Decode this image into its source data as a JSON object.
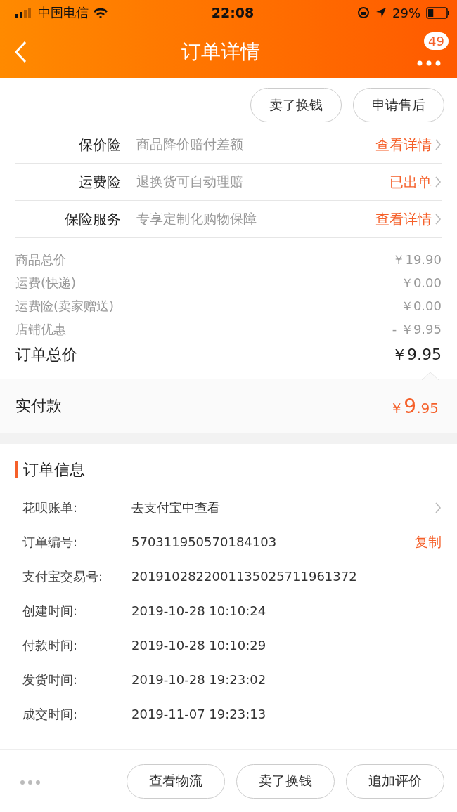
{
  "status_bar": {
    "carrier": "中国电信",
    "time": "22:08",
    "battery": "29%"
  },
  "nav": {
    "title": "订单详情",
    "badge": "49"
  },
  "top_actions": [
    "卖了换钱",
    "申请售后"
  ],
  "services": [
    {
      "label": "保价险",
      "desc": "商品降价赔付差额",
      "action": "查看详情"
    },
    {
      "label": "运费险",
      "desc": "退换货可自动理赔",
      "action": "已出单"
    },
    {
      "label": "保险服务",
      "desc": "专享定制化购物保障",
      "action": "查看详情"
    }
  ],
  "prices": [
    {
      "label": "商品总价",
      "value": "￥19.90"
    },
    {
      "label": "运费(快递)",
      "value": "￥0.00"
    },
    {
      "label": "运费险(卖家赠送)",
      "value": "￥0.00"
    },
    {
      "label": "店铺优惠",
      "value": "- ￥9.95"
    }
  ],
  "order_total": {
    "label": "订单总价",
    "value": "￥9.95"
  },
  "paid": {
    "label": "实付款",
    "currency": "￥",
    "integer": "9",
    "decimal": ".95"
  },
  "order_info": {
    "title": "订单信息",
    "rows": [
      {
        "kind": "link",
        "label": "花呗账单:",
        "value": "去支付宝中查看"
      },
      {
        "kind": "copy",
        "label": "订单编号:",
        "value": "570311950570184103",
        "action": "复制"
      },
      {
        "kind": "plain",
        "label": "支付宝交易号:",
        "value": "2019102822001135025711961372"
      },
      {
        "kind": "plain",
        "label": "创建时间:",
        "value": "2019-10-28 10:10:24"
      },
      {
        "kind": "plain",
        "label": "付款时间:",
        "value": "2019-10-28 10:10:29"
      },
      {
        "kind": "plain",
        "label": "发货时间:",
        "value": "2019-10-28 19:23:02"
      },
      {
        "kind": "plain",
        "label": "成交时间:",
        "value": "2019-11-07 19:23:13"
      }
    ]
  },
  "bottom_actions": [
    "查看物流",
    "卖了换钱",
    "追加评价"
  ]
}
